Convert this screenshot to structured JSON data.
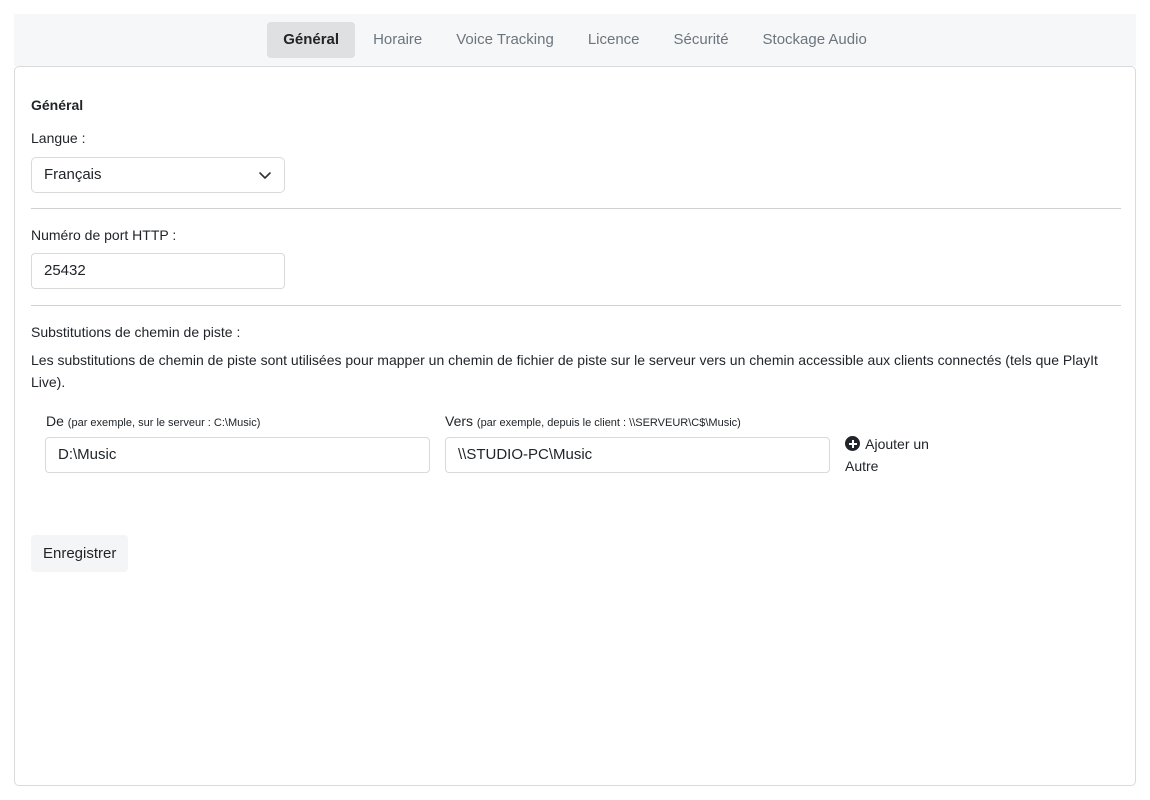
{
  "tabs": [
    {
      "label": "Général",
      "active": true
    },
    {
      "label": "Horaire",
      "active": false
    },
    {
      "label": "Voice Tracking",
      "active": false
    },
    {
      "label": "Licence",
      "active": false
    },
    {
      "label": "Sécurité",
      "active": false
    },
    {
      "label": "Stockage Audio",
      "active": false
    }
  ],
  "general": {
    "title": "Général",
    "language_label": "Langue :",
    "language_value": "Français"
  },
  "port": {
    "label": "Numéro de port HTTP :",
    "value": "25432"
  },
  "substitutions": {
    "label": "Substitutions de chemin de piste :",
    "description": "Les substitutions de chemin de piste sont utilisées pour mapper un chemin de fichier de piste sur le serveur vers un chemin accessible aux clients connectés (tels que PlayIt Live).",
    "from_label": "De",
    "from_hint": "(par exemple, sur le serveur : C:\\Music)",
    "from_value": "D:\\Music",
    "to_label": "Vers",
    "to_hint": "(par exemple, depuis le client : \\\\SERVEUR\\C$\\Music)",
    "to_value": "\\\\STUDIO-PC\\Music",
    "add_label": "Ajouter un Autre"
  },
  "save_label": "Enregistrer"
}
